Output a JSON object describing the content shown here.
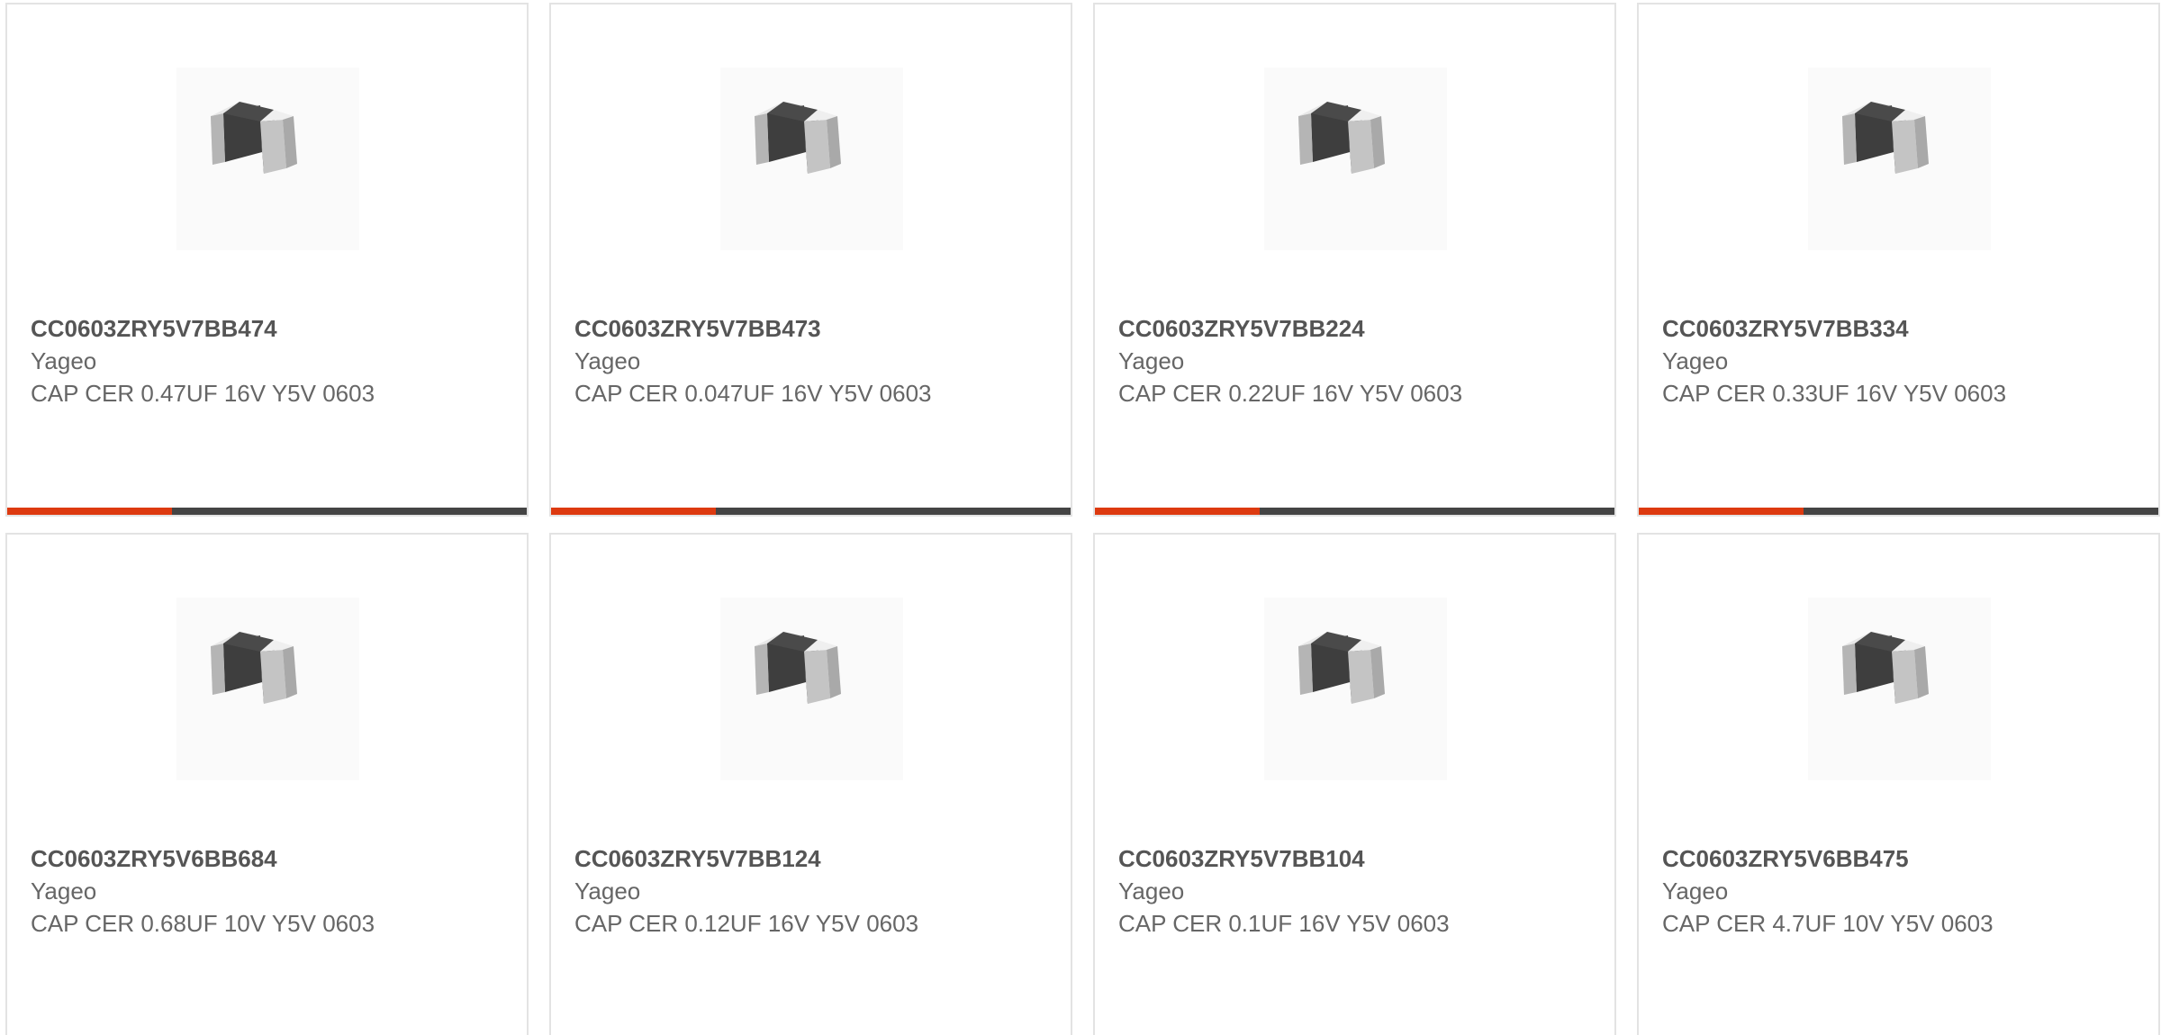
{
  "products": [
    {
      "part": "CC0603ZRY5V7BB474",
      "manufacturer": "Yageo",
      "description": "CAP CER 0.47UF 16V Y5V 0603"
    },
    {
      "part": "CC0603ZRY5V7BB473",
      "manufacturer": "Yageo",
      "description": "CAP CER 0.047UF 16V Y5V 0603"
    },
    {
      "part": "CC0603ZRY5V7BB224",
      "manufacturer": "Yageo",
      "description": "CAP CER 0.22UF 16V Y5V 0603"
    },
    {
      "part": "CC0603ZRY5V7BB334",
      "manufacturer": "Yageo",
      "description": "CAP CER 0.33UF 16V Y5V 0603"
    },
    {
      "part": "CC0603ZRY5V6BB684",
      "manufacturer": "Yageo",
      "description": "CAP CER 0.68UF 10V Y5V 0603"
    },
    {
      "part": "CC0603ZRY5V7BB124",
      "manufacturer": "Yageo",
      "description": "CAP CER 0.12UF 16V Y5V 0603"
    },
    {
      "part": "CC0603ZRY5V7BB104",
      "manufacturer": "Yageo",
      "description": "CAP CER 0.1UF 16V Y5V 0603"
    },
    {
      "part": "CC0603ZRY5V6BB475",
      "manufacturer": "Yageo",
      "description": "CAP CER 4.7UF 10V Y5V 0603"
    }
  ],
  "icons": {
    "product_image": "ceramic-capacitor-chip-icon"
  },
  "colors": {
    "accent": "#dd3a10",
    "bar_track": "#444444",
    "card_border": "#e3e3e3",
    "text": "#666666"
  }
}
